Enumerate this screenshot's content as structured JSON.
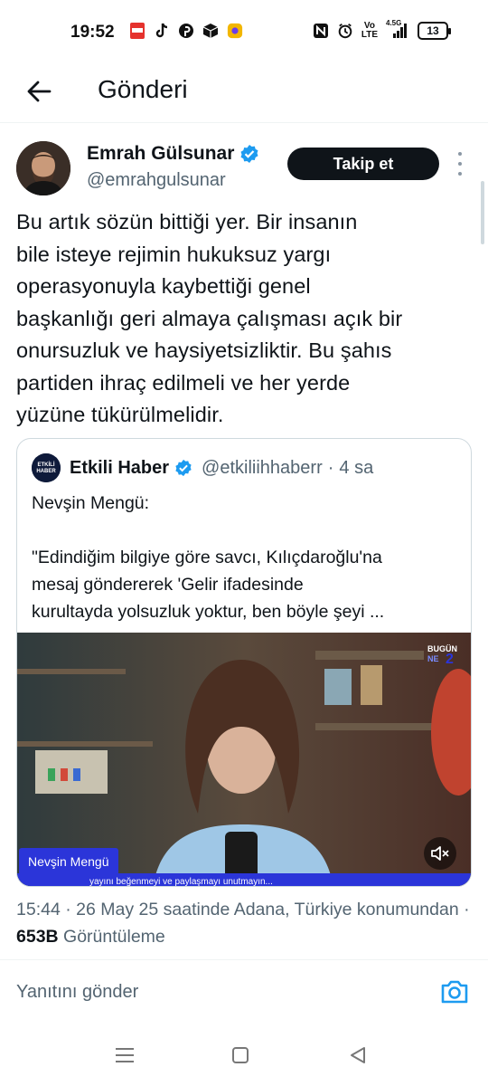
{
  "status_bar": {
    "time": "19:52",
    "left_icons": [
      "pdf-icon",
      "tiktok-icon",
      "pinterest-icon",
      "cube-icon",
      "app-icon"
    ],
    "right_icons": [
      "nfc-icon",
      "alarm-icon",
      "volte-icon",
      "signal-icon"
    ],
    "network_top": "Vo",
    "network_bottom": "LTE",
    "signal_label": "4.5G",
    "battery": "13"
  },
  "header": {
    "title": "Gönderi",
    "back_icon": "arrow-left-icon"
  },
  "author": {
    "name": "Emrah Gülsunar",
    "handle": "@emrahgulsunar",
    "verified_color": "#1d9bf0",
    "follow_label": "Takip et"
  },
  "tweet": {
    "text": "Bu artık sözün bittiği yer. Bir insanın\nbile isteye rejimin hukuksuz yargı\noperasyonuyla kaybettiği genel\nbaşkanlığı geri almaya çalışması açık bir\nonursuzluk ve haysiyetsizliktir. Bu şahıs\npartiden ihraç edilmeli ve her yerde\nyüzüne tükürülmelidir."
  },
  "quote": {
    "avatar_text": "ETKİLİ HABER",
    "name": "Etkili Haber",
    "handle": "@etkiliihhaberr",
    "separator": "·",
    "time": "4 sa",
    "text": "Nevşin Mengü:\n\n\"Edindiğim bilgiye göre savcı, Kılıçdaroğlu'na\nmesaj göndererek 'Gelir ifadesinde\nkurultayda yolsuzluk yoktur, ben böyle şeyi ...",
    "media": {
      "name_label": "Nevşin Mengü",
      "caption": "yayını beğenmeyi ve paylaşmayı unutmayın...",
      "brand_top": "BUGÜN",
      "brand_bottom": "NE",
      "accent_color": "#2b35d9"
    }
  },
  "meta": {
    "time": "15:44",
    "date": "26 May 25",
    "location_text": "saatinde Adana, Türkiye konumundan",
    "views_count": "653B",
    "views_label": "Görüntüleme",
    "dot": "·"
  },
  "reply": {
    "placeholder": "Yanıtını gönder",
    "camera_color": "#1d9bf0"
  },
  "nav": {
    "icons": [
      "menu-icon",
      "home-icon",
      "back-triangle-icon"
    ]
  }
}
